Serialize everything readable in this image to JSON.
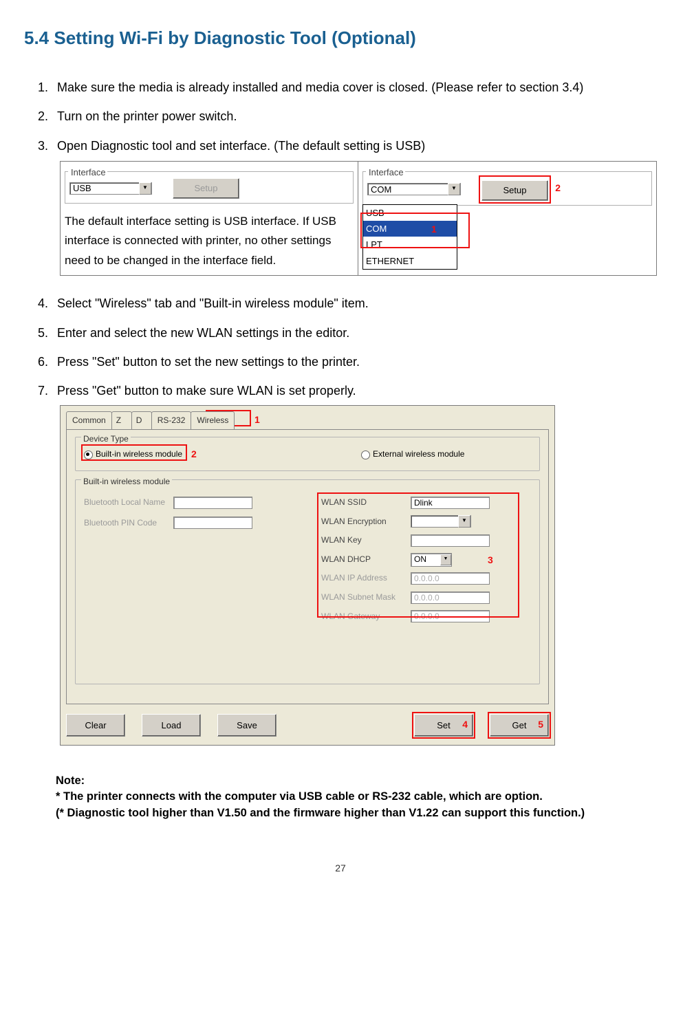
{
  "heading": "5.4    Setting Wi-Fi by Diagnostic Tool (Optional)",
  "steps": {
    "s1": "Make sure the media is already installed and media cover is closed. (Please refer to section 3.4)",
    "s2": "Turn on the printer power switch.",
    "s3": "Open Diagnostic tool and set interface. (The default setting is USB)",
    "s4": "Select \"Wireless\" tab and \"Built-in wireless module\" item.",
    "s5": "Enter and select the new WLAN settings in the editor.",
    "s6": "Press \"Set\" button to set the new settings to the printer.",
    "s7": "Press \"Get\" button to make sure WLAN is set properly."
  },
  "iface": {
    "legend": "Interface",
    "usb": "USB",
    "com": "COM",
    "setup": "Setup",
    "options": {
      "usb": "USB",
      "com": "COM",
      "lpt": "LPT",
      "eth": "ETHERNET"
    },
    "caption": "The default interface setting is USB interface. If USB interface is connected with printer, no other settings need to be changed in the interface field.",
    "m1": "1",
    "m2": "2"
  },
  "wireless": {
    "tabs": {
      "common": "Common",
      "z": "Z",
      "d": "D",
      "rs232": "RS-232",
      "wireless": "Wireless"
    },
    "device_type": "Device Type",
    "builtin": "Built-in wireless module",
    "external": "External wireless module",
    "group_builtin": "Built-in wireless module",
    "bt_name": "Bluetooth Local Name",
    "bt_pin": "Bluetooth PIN Code",
    "ssid_lbl": "WLAN SSID",
    "ssid_val": "Dlink",
    "enc_lbl": "WLAN Encryption",
    "key_lbl": "WLAN Key",
    "dhcp_lbl": "WLAN DHCP",
    "dhcp_val": "ON",
    "ip_lbl": "WLAN IP Address",
    "ip_val": "0.0.0.0",
    "mask_lbl": "WLAN Subnet Mask",
    "mask_val": "0.0.0.0",
    "gw_lbl": "WLAN Gateway",
    "gw_val": "0.0.0.0",
    "btn_clear": "Clear",
    "btn_load": "Load",
    "btn_save": "Save",
    "btn_set": "Set",
    "btn_get": "Get",
    "m1": "1",
    "m2": "2",
    "m3": "3",
    "m4": "4",
    "m5": "5"
  },
  "note": {
    "title": "Note:",
    "l1": "* The printer connects with the computer via USB cable or RS-232 cable, which are option.",
    "l2": "(* Diagnostic tool higher than V1.50 and the firmware higher than V1.22 can support this function.)"
  },
  "page": "27"
}
